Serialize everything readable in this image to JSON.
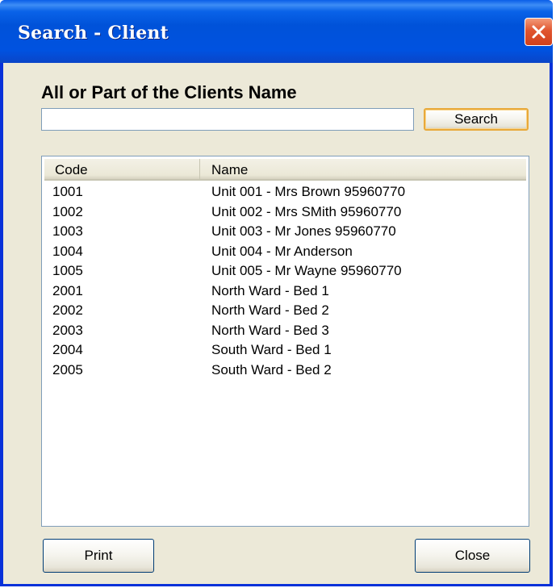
{
  "window": {
    "title": "Search - Client"
  },
  "search": {
    "prompt": "All or Part of the Clients Name",
    "value": "",
    "button_label": "Search"
  },
  "list": {
    "columns": [
      "Code",
      "Name"
    ],
    "rows": [
      {
        "code": "1001",
        "name": "Unit 001 - Mrs Brown 95960770"
      },
      {
        "code": "1002",
        "name": "Unit 002 - Mrs SMith 95960770"
      },
      {
        "code": "1003",
        "name": "Unit 003 - Mr Jones 95960770"
      },
      {
        "code": "1004",
        "name": "Unit 004 - Mr Anderson"
      },
      {
        "code": "1005",
        "name": "Unit 005 - Mr Wayne 95960770"
      },
      {
        "code": "2001",
        "name": "North Ward - Bed 1"
      },
      {
        "code": "2002",
        "name": "North Ward - Bed 2"
      },
      {
        "code": "2003",
        "name": "North Ward - Bed 3"
      },
      {
        "code": "2004",
        "name": "South Ward - Bed 1"
      },
      {
        "code": "2005",
        "name": "South Ward - Bed 2"
      }
    ]
  },
  "footer": {
    "print_label": "Print",
    "close_label": "Close"
  },
  "icons": {
    "close": "close-icon"
  },
  "colors": {
    "titlebar": "#0052d9",
    "client_area": "#ece9d8",
    "close_button": "#e0552f",
    "default_button_border": "#e8a93b"
  }
}
